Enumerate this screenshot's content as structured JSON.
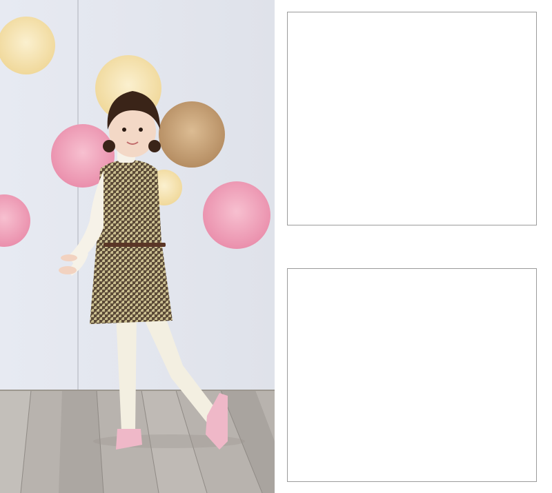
{
  "photo": {
    "subject": "girl-in-houndstooth-dress",
    "colors": {
      "wall": "#e4e7ef",
      "floor": "#b7b2ad",
      "dress_dark": "#5b4a37",
      "dress_light": "#c9bd8f",
      "sweater": "#f6f2e8",
      "tights": "#f3efe1",
      "shoes": "#efb8c8",
      "hair": "#3a2418",
      "pompom_pink": "#f29bb6",
      "pompom_cream": "#f6e2b0",
      "pompom_tan": "#c9a47a"
    }
  },
  "panels": [
    {
      "name": "image-placeholder-top"
    },
    {
      "name": "image-placeholder-bottom"
    }
  ]
}
